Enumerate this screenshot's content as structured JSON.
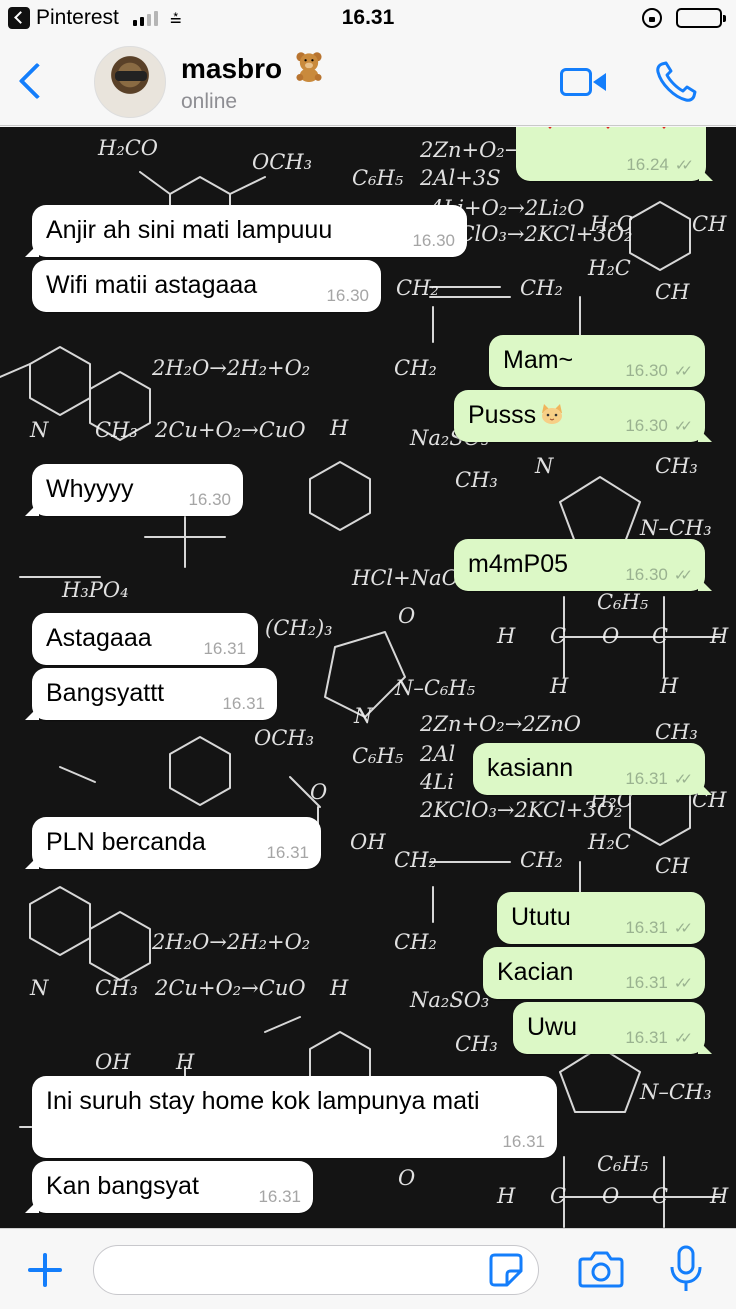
{
  "status_bar": {
    "back_app": "Pinterest",
    "time": "16.31",
    "wifi_symbol": "⩮",
    "icons": [
      "signal-bars-icon",
      "wifi-icon",
      "rotation-lock-icon",
      "battery-icon"
    ]
  },
  "header": {
    "contact_name": "masbro",
    "contact_status": "online",
    "icons": [
      "back-chevron-icon",
      "avatar",
      "teddy-bear-emoji",
      "video-call-icon",
      "phone-call-icon"
    ]
  },
  "messages": [
    {
      "dir": "out",
      "text": "",
      "time": "16.24",
      "read": true
    },
    {
      "dir": "in",
      "text": "Anjir ah sini mati lampuuu",
      "time": "16.30"
    },
    {
      "dir": "in",
      "text": "Wifi matii astagaaa",
      "time": "16.30"
    },
    {
      "dir": "out",
      "text": "Mam~",
      "time": "16.30",
      "read": true
    },
    {
      "dir": "out",
      "text": "Pusss",
      "emoji": "cat-emoji",
      "time": "16.30",
      "read": true
    },
    {
      "dir": "in",
      "text": "Whyyyy",
      "time": "16.30"
    },
    {
      "dir": "out",
      "text": "m4mP05",
      "time": "16.30",
      "read": true
    },
    {
      "dir": "in",
      "text": "Astagaaa",
      "time": "16.31"
    },
    {
      "dir": "in",
      "text": "Bangsyattt",
      "time": "16.31"
    },
    {
      "dir": "out",
      "text": "kasiann",
      "time": "16.31",
      "read": true
    },
    {
      "dir": "in",
      "text": "PLN bercanda",
      "time": "16.31"
    },
    {
      "dir": "out",
      "text": "Ututu",
      "time": "16.31",
      "read": true
    },
    {
      "dir": "out",
      "text": "Kacian",
      "time": "16.31",
      "read": true
    },
    {
      "dir": "out",
      "text": "Uwu",
      "time": "16.31",
      "read": true
    },
    {
      "dir": "in",
      "text": "Ini suruh stay home kok lampunya mati",
      "time": "16.31"
    },
    {
      "dir": "in",
      "text": "Kan bangsyat",
      "time": "16.31"
    }
  ],
  "input_bar": {
    "placeholder": "",
    "icons": [
      "plus-icon",
      "sticker-icon",
      "camera-icon",
      "microphone-icon"
    ]
  },
  "colors": {
    "accent": "#147efb",
    "outgoing_bubble": "#dcf8c6",
    "incoming_bubble": "#ffffff",
    "chat_background": "#141414"
  },
  "background_text": {
    "formulas": [
      "H₂CO",
      "OCH₃",
      "2Zn+O₂→2ZnO",
      "2Al+3S→Al₂S₃",
      "4Li+O₂→2Li₂O",
      "2KClO₃→2KCl+3O₂",
      "CH₂",
      "2H₂O→2H₂+O₂",
      "CH₃",
      "2Cu+O₂→CuO",
      "Na₂SO₃",
      "H₃PO₄",
      "HCl+NaOH",
      "C₆H₅",
      "N",
      "H",
      "O",
      "OH",
      "CH",
      "C",
      "N–C₆H₅",
      "N–CH₃"
    ]
  }
}
